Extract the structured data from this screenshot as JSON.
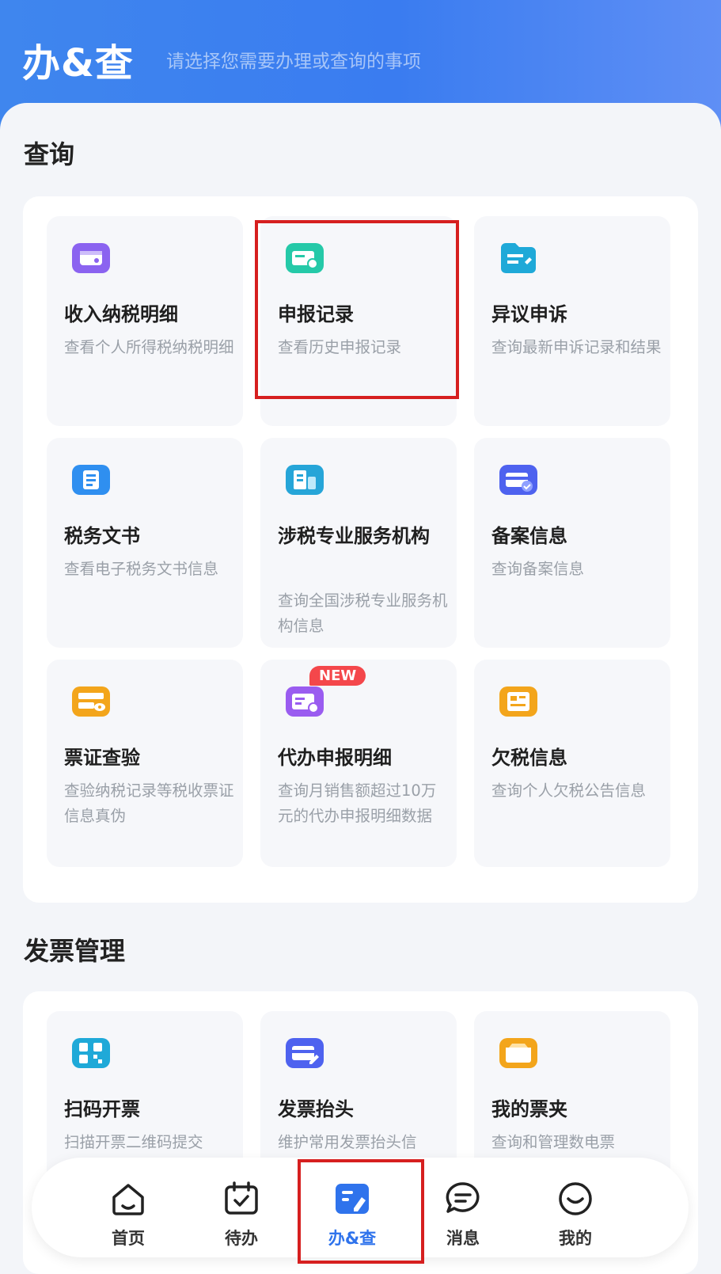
{
  "header": {
    "title": "办&查",
    "subtitle": "请选择您需要办理或查询的事项"
  },
  "sections": [
    {
      "title": "查询",
      "cards": [
        {
          "title": "收入纳税明细",
          "desc": "查看个人所得税纳税明细",
          "icon": "wallet-icon",
          "color": "#8b63f0"
        },
        {
          "title": "申报记录",
          "desc": "查看历史申报记录",
          "icon": "record-search-icon",
          "color": "#25c9a8"
        },
        {
          "title": "异议申诉",
          "desc": "查询最新申诉记录和结果",
          "icon": "folder-appeal-icon",
          "color": "#1fa9d8"
        },
        {
          "title": "税务文书",
          "desc": "查看电子税务文书信息",
          "icon": "document-icon",
          "color": "#2f8ff0"
        },
        {
          "title": "涉税专业服务机构",
          "desc": "查询全国涉税专业服务机构信息",
          "icon": "institution-icon",
          "color": "#26a5d8"
        },
        {
          "title": "备案信息",
          "desc": "查询备案信息",
          "icon": "filing-icon",
          "color": "#4e62ef"
        },
        {
          "title": "票证查验",
          "desc": "查验纳税记录等税收票证信息真伪",
          "icon": "ticket-verify-icon",
          "color": "#f3a51b"
        },
        {
          "title": "代办申报明细",
          "desc": "查询月销售额超过10万元的代办申报明细数据",
          "icon": "agent-declare-icon",
          "color": "#9a5cf0",
          "badge": "NEW"
        },
        {
          "title": "欠税信息",
          "desc": "查询个人欠税公告信息",
          "icon": "tax-arrears-icon",
          "color": "#f3a51b"
        }
      ]
    },
    {
      "title": "发票管理",
      "cards": [
        {
          "title": "扫码开票",
          "desc": "扫描开票二维码提交",
          "icon": "qr-code-icon",
          "color": "#1fa9d8"
        },
        {
          "title": "发票抬头",
          "desc": "维护常用发票抬头信",
          "icon": "invoice-edit-icon",
          "color": "#4e62ef"
        },
        {
          "title": "我的票夹",
          "desc": "查询和管理数电票",
          "icon": "ticket-folder-icon",
          "color": "#f3a51b"
        }
      ]
    }
  ],
  "tabbar": [
    {
      "label": "首页",
      "icon": "home-icon"
    },
    {
      "label": "待办",
      "icon": "calendar-check-icon"
    },
    {
      "label": "办&查",
      "icon": "search-doc-icon",
      "active": true
    },
    {
      "label": "消息",
      "icon": "message-icon"
    },
    {
      "label": "我的",
      "icon": "smile-icon"
    }
  ]
}
